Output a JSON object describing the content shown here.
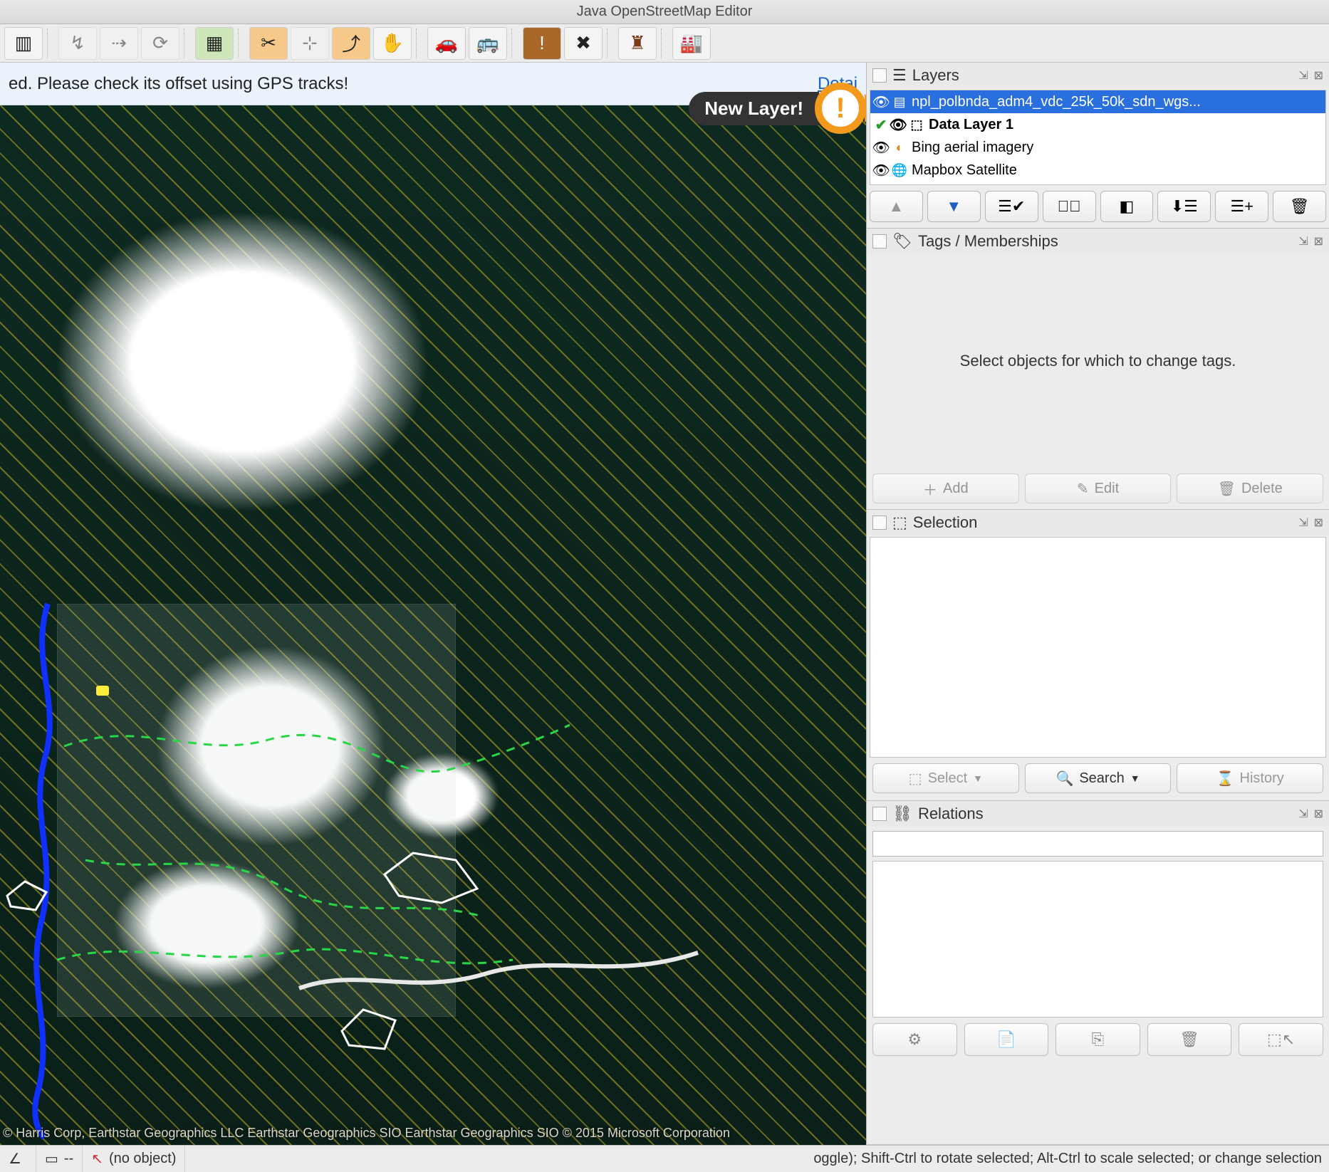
{
  "window": {
    "title": "Java OpenStreetMap Editor"
  },
  "banner": {
    "message": "ed. Please check its offset using GPS tracks!",
    "details_label": "Detai",
    "new_layer_label": "New Layer!"
  },
  "toolbar": {
    "icons": [
      "layers-icon",
      "",
      "select-way-icon",
      "draw-nodes-icon",
      "refresh-icon",
      "",
      "imagery-icon",
      "",
      "split-way-icon",
      "combine-way-icon",
      "reverse-way-icon",
      "pan-icon",
      "",
      "car-icon",
      "bus-icon",
      "",
      "warning-icon",
      "food-icon",
      "",
      "castle-icon",
      "",
      "factory-icon"
    ]
  },
  "panels": {
    "layers": {
      "title": "Layers",
      "items": [
        {
          "name": "npl_polbnda_adm4_vdc_25k_50k_sdn_wgs...",
          "selected": true,
          "active": false
        },
        {
          "name": "Data Layer 1",
          "selected": false,
          "active": true,
          "bold": true
        },
        {
          "name": "Bing aerial imagery",
          "selected": false,
          "active": false
        },
        {
          "name": "Mapbox Satellite",
          "selected": false,
          "active": false
        }
      ],
      "buttons": {
        "up": "↑",
        "down": "↓",
        "activate": "act",
        "toggle": "tog",
        "opacity": "opa",
        "merge": "mer",
        "dup": "dup",
        "delete": "del"
      }
    },
    "tags": {
      "title": "Tags / Memberships",
      "placeholder": "Select objects for which to change tags.",
      "add": "Add",
      "edit": "Edit",
      "delete": "Delete"
    },
    "selection": {
      "title": "Selection",
      "select": "Select",
      "search": "Search",
      "history": "History"
    },
    "relations": {
      "title": "Relations"
    }
  },
  "map": {
    "attribution": "© Harris Corp, Earthstar Geographics LLC Earthstar Geographics  SIO Earthstar Geographics  SIO © 2015 Microsoft Corporation"
  },
  "status": {
    "angle": "",
    "scale": "--",
    "object": "(no object)",
    "hint": "oggle); Shift-Ctrl to rotate selected; Alt-Ctrl to scale selected; or change selection"
  }
}
